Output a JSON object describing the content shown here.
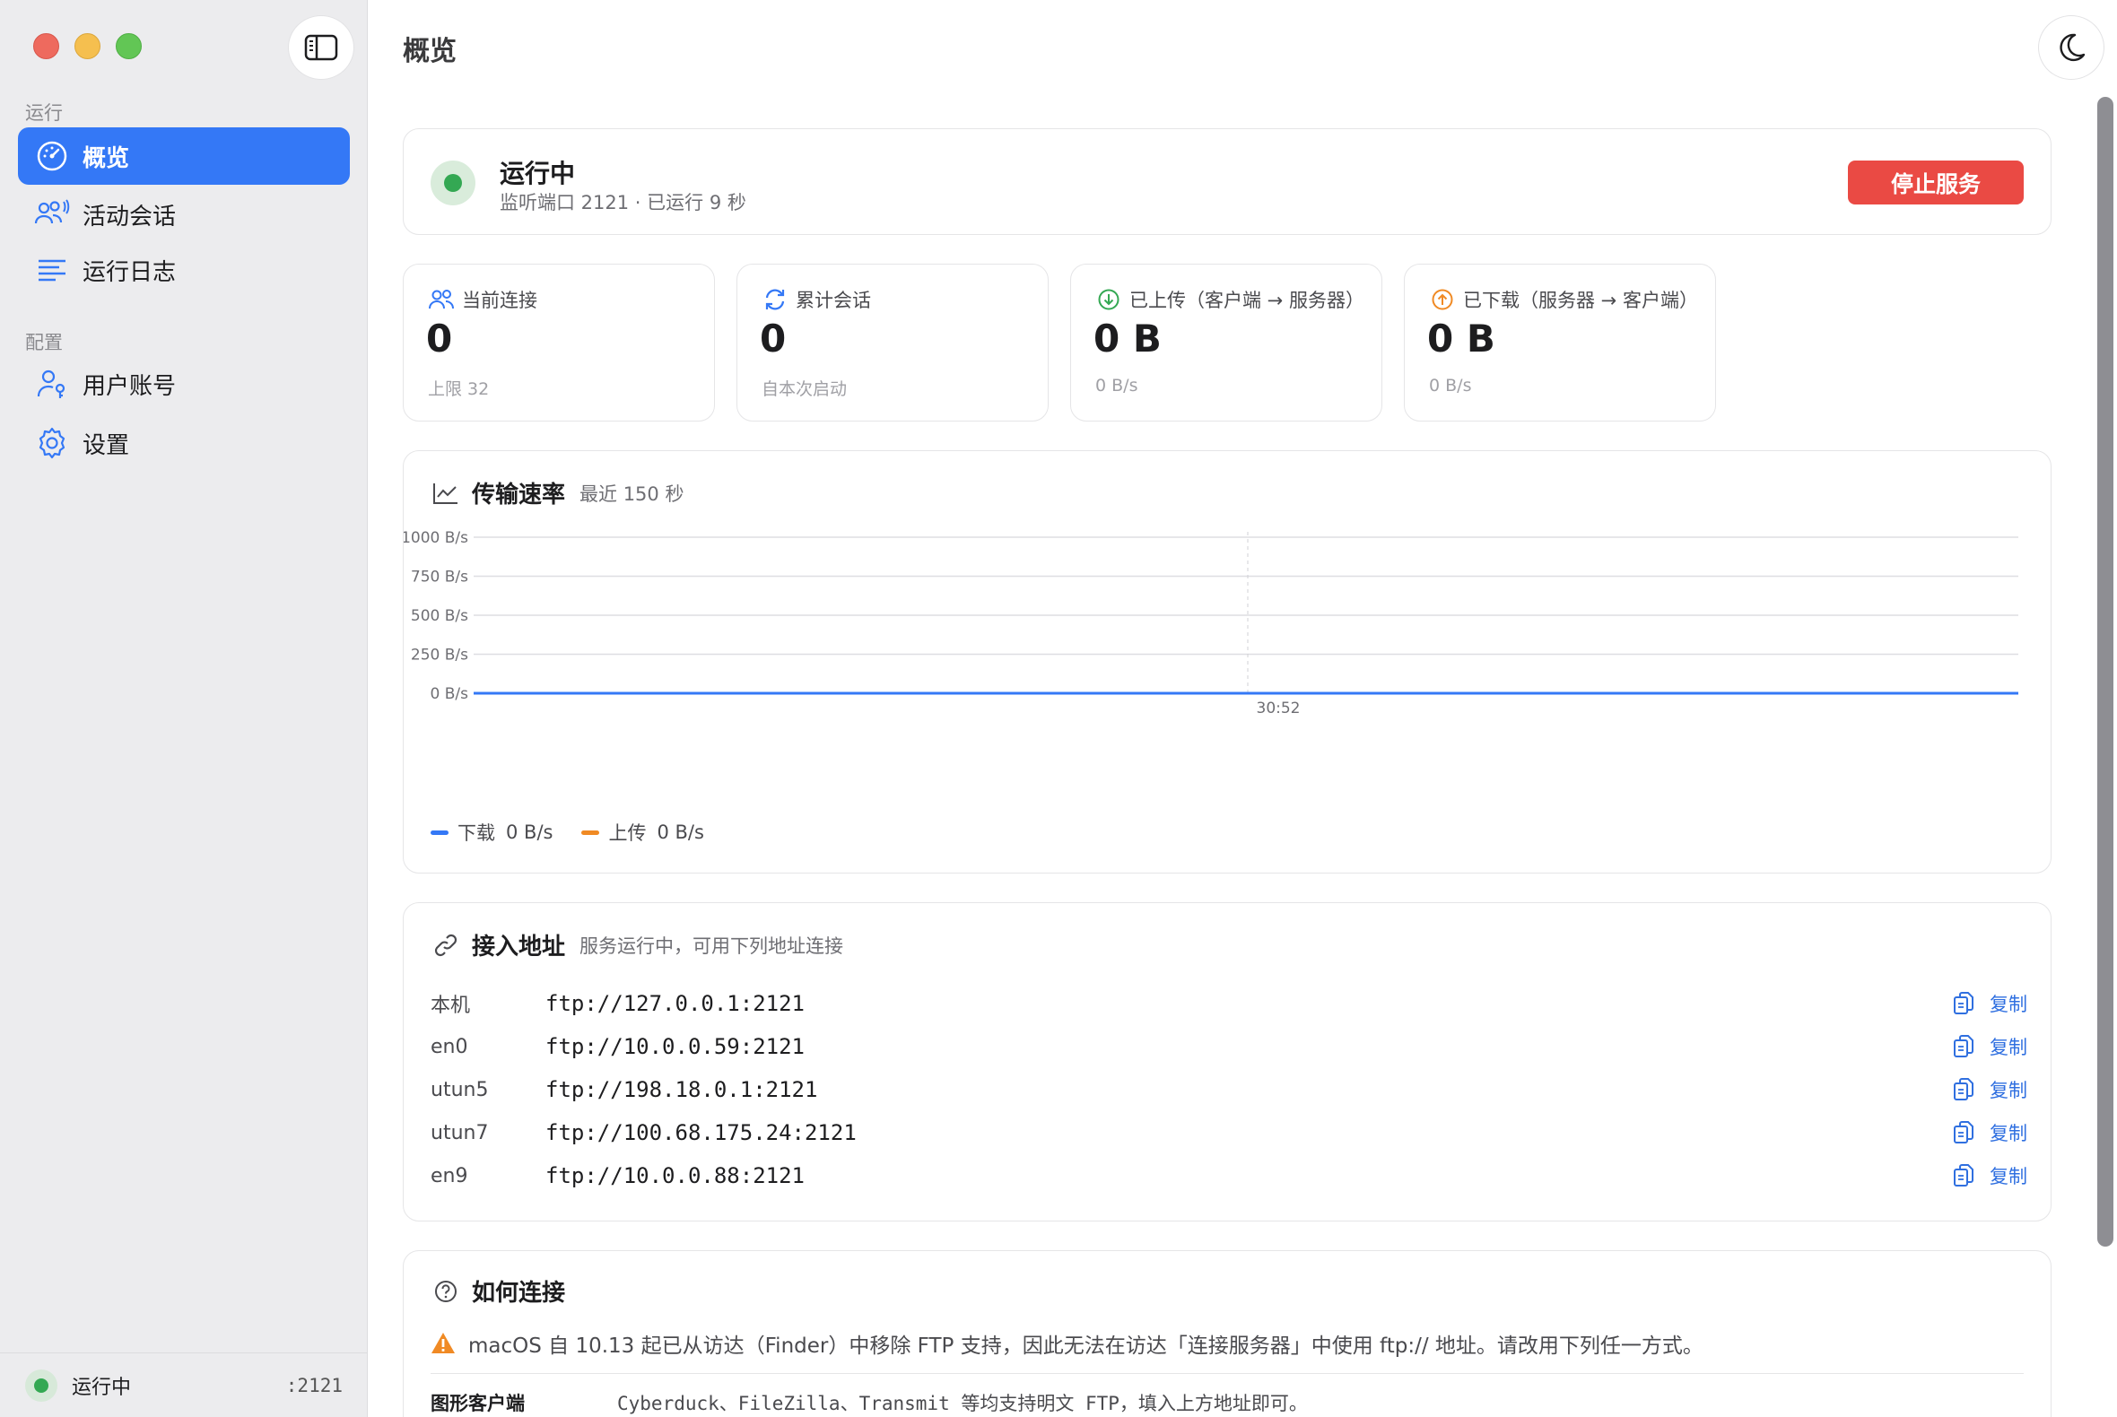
{
  "sidebar": {
    "section_run": "运行",
    "section_config": "配置",
    "items": [
      {
        "label": "概览",
        "icon": "gauge-icon",
        "active": true
      },
      {
        "label": "活动会话",
        "icon": "users-broadcast-icon",
        "active": false
      },
      {
        "label": "运行日志",
        "icon": "list-lines-icon",
        "active": false
      },
      {
        "label": "用户账号",
        "icon": "user-key-icon",
        "active": false
      },
      {
        "label": "设置",
        "icon": "gear-icon",
        "active": false
      }
    ],
    "footer": {
      "status": "运行中",
      "port": ":2121"
    }
  },
  "header": {
    "title": "概览"
  },
  "status": {
    "title": "运行中",
    "subtitle": "监听端口 2121 · 已运行 9 秒",
    "stop_button": "停止服务",
    "color": "#34a853"
  },
  "stats": [
    {
      "label": "当前连接",
      "value": "0",
      "sub": "上限 32",
      "icon": "users-icon",
      "color": "#3478f6"
    },
    {
      "label": "累计会话",
      "value": "0",
      "sub": "自本次启动",
      "icon": "refresh-icon",
      "color": "#3478f6"
    },
    {
      "label": "已上传（客户端 → 服务器）",
      "value": "0 B",
      "sub": "0 B/s",
      "icon": "arrow-down-circle-icon",
      "color": "#34a853"
    },
    {
      "label": "已下载（服务器 → 客户端）",
      "value": "0 B",
      "sub": "0 B/s",
      "icon": "arrow-up-circle-icon",
      "color": "#f08a24"
    }
  ],
  "rate_chart": {
    "title": "传输速率",
    "subtitle": "最近 150 秒",
    "legend": [
      {
        "name": "下载",
        "value": "0 B/s",
        "color": "#3478f6"
      },
      {
        "name": "上传",
        "value": "0 B/s",
        "color": "#f08a24"
      }
    ]
  },
  "chart_data": {
    "type": "line",
    "title": "传输速率",
    "ylim": [
      0,
      1000
    ],
    "y_ticks": [
      "1000 B/s",
      "750 B/s",
      "500 B/s",
      "250 B/s",
      "0 B/s"
    ],
    "x_ticks": [
      "30:52"
    ],
    "grid": true,
    "series": [
      {
        "name": "下载",
        "values": [
          0,
          0
        ],
        "color": "#3478f6"
      },
      {
        "name": "上传",
        "values": [
          0,
          0
        ],
        "color": "#f08a24"
      }
    ]
  },
  "addresses": {
    "title": "接入地址",
    "subtitle": "服务运行中，可用下列地址连接",
    "copy_label": "复制",
    "rows": [
      {
        "iface": "本机",
        "url": "ftp://127.0.0.1:2121"
      },
      {
        "iface": "en0",
        "url": "ftp://10.0.0.59:2121"
      },
      {
        "iface": "utun5",
        "url": "ftp://198.18.0.1:2121"
      },
      {
        "iface": "utun7",
        "url": "ftp://100.68.175.24:2121"
      },
      {
        "iface": "en9",
        "url": "ftp://10.0.0.88:2121"
      }
    ]
  },
  "help": {
    "title": "如何连接",
    "warning": "macOS 自 10.13 起已从访达（Finder）中移除 FTP 支持，因此无法在访达「连接服务器」中使用 ftp:// 地址。请改用下列任一方式。",
    "rows": [
      {
        "key": "图形客户端",
        "value": "Cyberduck、FileZilla、Transmit 等均支持明文 FTP，填入上方地址即可。"
      }
    ]
  }
}
